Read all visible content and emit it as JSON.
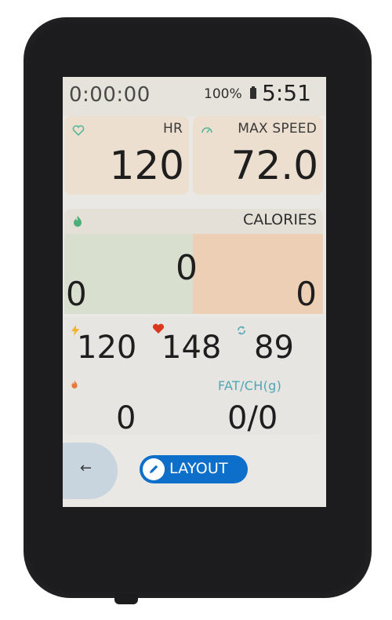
{
  "status": {
    "elapsed_time": "0:00:00",
    "battery": "100%",
    "clock": "5:51"
  },
  "fields": {
    "hr": {
      "label": "HR",
      "value": "120",
      "icon": "heart-outline-icon"
    },
    "max_speed": {
      "label": "MAX SPEED",
      "value": "72.0",
      "icon": "speedometer-icon"
    }
  },
  "calories": {
    "label": "CALORIES",
    "icon": "flame-icon",
    "center_value": "0",
    "left_value": "0",
    "right_value": "0"
  },
  "stats": {
    "power": {
      "value": "120",
      "icon": "lightning-icon"
    },
    "heart": {
      "value": "148",
      "icon": "heart-filled-icon"
    },
    "cadence": {
      "value": "89",
      "icon": "cycle-arrows-icon"
    },
    "burn": {
      "value": "0",
      "icon": "flame-icon"
    },
    "fat_ch": {
      "label": "FAT/CH(g)",
      "value": "0/0"
    }
  },
  "nav": {
    "back_icon": "←",
    "layout_label": "LAYOUT"
  },
  "colors": {
    "accent": "#0d6fc9",
    "teal": "#4fa7b4",
    "zone_green": "#d8dfcf",
    "zone_orange": "#eccfb4",
    "heart_red": "#d9381e"
  }
}
